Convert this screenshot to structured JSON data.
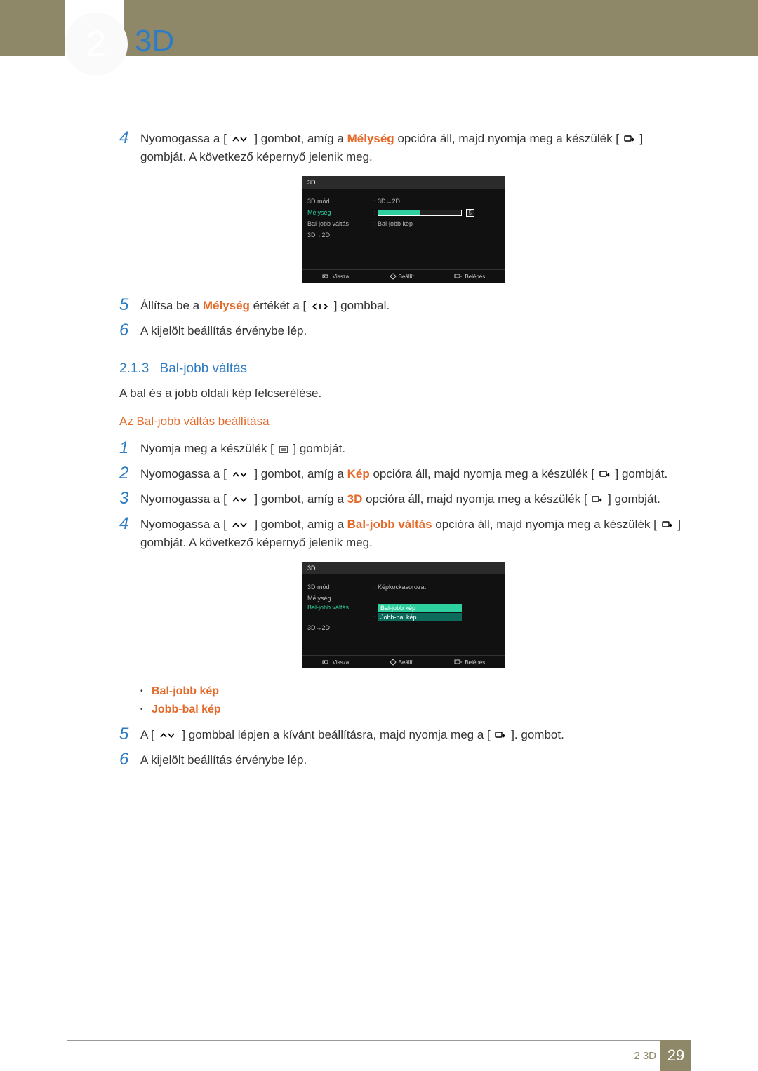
{
  "header": {
    "chapter": "2",
    "title": "3D"
  },
  "steps_a": {
    "s4_pre": "Nyomogassa a [",
    "s4_mid": "] gombot, amíg a ",
    "s4_hl": "Mélység",
    "s4_post": " opcióra áll, majd nyomja meg a készülék [",
    "s4_end": "] gombját. A következő képernyő jelenik meg.",
    "s5_pre": "Állítsa be a ",
    "s5_hl": "Mélység",
    "s5_mid": " értékét a [",
    "s5_end": "] gombbal.",
    "s6": "A kijelölt beállítás érvénybe lép."
  },
  "osd1": {
    "title": "3D",
    "rows": {
      "mode_label": "3D mód",
      "mode_value": ": 3D→2D",
      "depth_label": "Mélység",
      "depth_value": "5",
      "swap_label": "Bal-jobb váltás",
      "swap_value": ": Bal-jobb kép",
      "conv_label": "3D→2D"
    },
    "footer": {
      "back": "Vissza",
      "set": "Beállít",
      "enter": "Belépés"
    },
    "slider_pct": 50
  },
  "section": {
    "num": "2.1.3",
    "title": "Bal-jobb váltás"
  },
  "section_desc": "A bal és a jobb oldali kép felcserélése.",
  "subsection": "Az Bal-jobb váltás beállítása",
  "steps_b": {
    "s1_pre": "Nyomja meg a készülék [",
    "s1_end": "] gombját.",
    "s2_pre": "Nyomogassa a [",
    "s2_mid": "] gombot, amíg a ",
    "s2_hl": "Kép",
    "s2_post": " opcióra áll, majd nyomja meg a készülék [",
    "s2_end": "] gombját.",
    "s3_pre": "Nyomogassa a [",
    "s3_mid": "] gombot, amíg a ",
    "s3_hl": "3D",
    "s3_post": " opcióra áll, majd nyomja meg a készülék [",
    "s3_end": "] gombját.",
    "s4_pre": "Nyomogassa a [",
    "s4_mid": "] gombot, amíg a ",
    "s4_hl": "Bal-jobb váltás",
    "s4_post": " opcióra áll, majd nyomja meg a készülék [",
    "s4_end": "] gombját. A következő képernyő jelenik meg.",
    "opt1": "Bal-jobb kép",
    "opt2": "Jobb-bal kép",
    "s5_pre": "A [",
    "s5_mid": "] gombbal lépjen a kívánt beállításra, majd nyomja meg a [",
    "s5_end": "]. gombot.",
    "s6": "A kijelölt beállítás érvénybe lép."
  },
  "osd2": {
    "title": "3D",
    "rows": {
      "mode_label": "3D mód",
      "mode_value": ": Képkockasorozat",
      "depth_label": "Mélység",
      "swap_label": "Bal-jobb váltás",
      "opt1": "Bal-jobb kép",
      "opt2": "Jobb-bal kép",
      "conv_label": "3D→2D"
    },
    "footer": {
      "back": "Vissza",
      "set": "Beállít",
      "enter": "Belépés"
    }
  },
  "footer": {
    "label": "2 3D",
    "page": "29"
  }
}
